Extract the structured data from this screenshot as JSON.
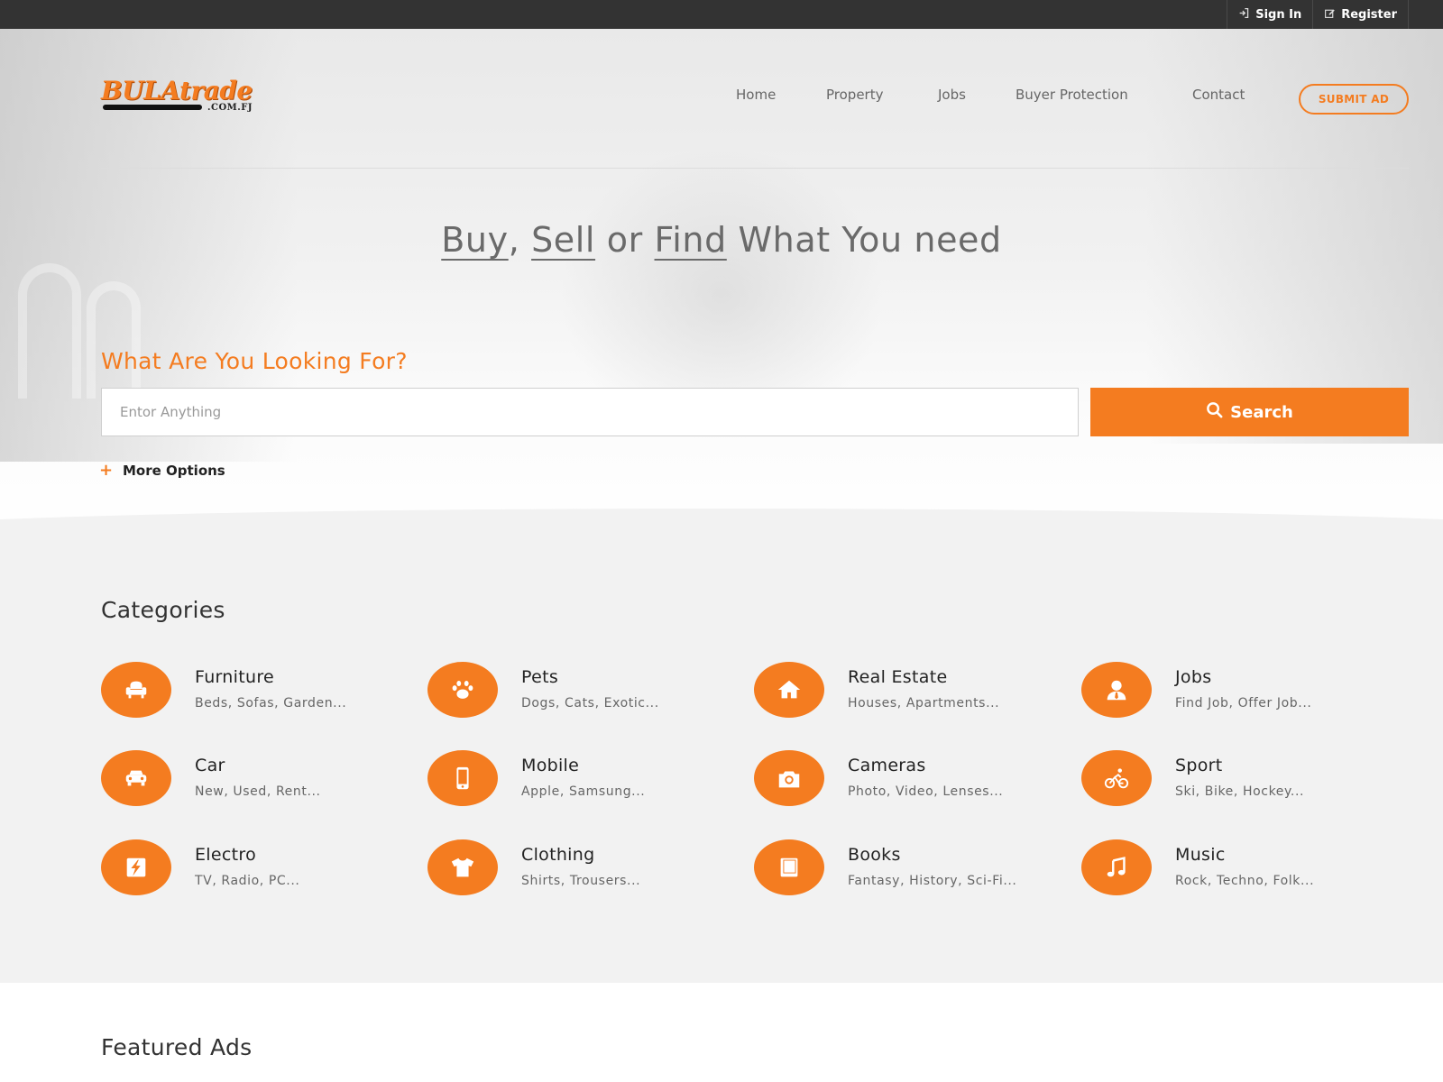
{
  "topbar": {
    "sign_in": "Sign In",
    "register": "Register"
  },
  "brand": {
    "logo_word": "BULAtrade",
    "logo_tld": ".COM.FJ",
    "accent": "#f47c20"
  },
  "nav": {
    "items": [
      "Home",
      "Property",
      "Jobs",
      "Buyer Protection",
      "Contact"
    ],
    "submit_label": "SUBMIT AD"
  },
  "hero": {
    "headline": {
      "w1": "Buy",
      "sep1": ",",
      "w2": "Sell",
      "mid": "or",
      "w3": "Find",
      "tail": "What You need"
    },
    "prompt": "What Are You Looking For?",
    "search_placeholder": "Entor Anything",
    "search_label": "Search",
    "more_options": "More Options"
  },
  "categories": {
    "title": "Categories",
    "items": [
      {
        "name": "Furniture",
        "sub": "Beds, Sofas, Garden...",
        "icon": "armchair-icon"
      },
      {
        "name": "Pets",
        "sub": "Dogs, Cats, Exotic...",
        "icon": "paw-icon"
      },
      {
        "name": "Real Estate",
        "sub": "Houses, Apartments...",
        "icon": "house-icon"
      },
      {
        "name": "Jobs",
        "sub": "Find Job, Offer Job...",
        "icon": "person-icon"
      },
      {
        "name": "Car",
        "sub": "New, Used, Rent...",
        "icon": "car-icon"
      },
      {
        "name": "Mobile",
        "sub": "Apple, Samsung...",
        "icon": "mobile-icon"
      },
      {
        "name": "Cameras",
        "sub": "Photo, Video, Lenses...",
        "icon": "camera-icon"
      },
      {
        "name": "Sport",
        "sub": "Ski, Bike, Hockey...",
        "icon": "cyclist-icon"
      },
      {
        "name": "Electro",
        "sub": "TV, Radio, PC...",
        "icon": "lightning-icon"
      },
      {
        "name": "Clothing",
        "sub": "Shirts, Trousers...",
        "icon": "tshirt-icon"
      },
      {
        "name": "Books",
        "sub": "Fantasy, History, Sci-Fi...",
        "icon": "book-icon"
      },
      {
        "name": "Music",
        "sub": "Rock, Techno, Folk...",
        "icon": "music-note-icon"
      }
    ]
  },
  "featured": {
    "title": "Featured Ads"
  }
}
